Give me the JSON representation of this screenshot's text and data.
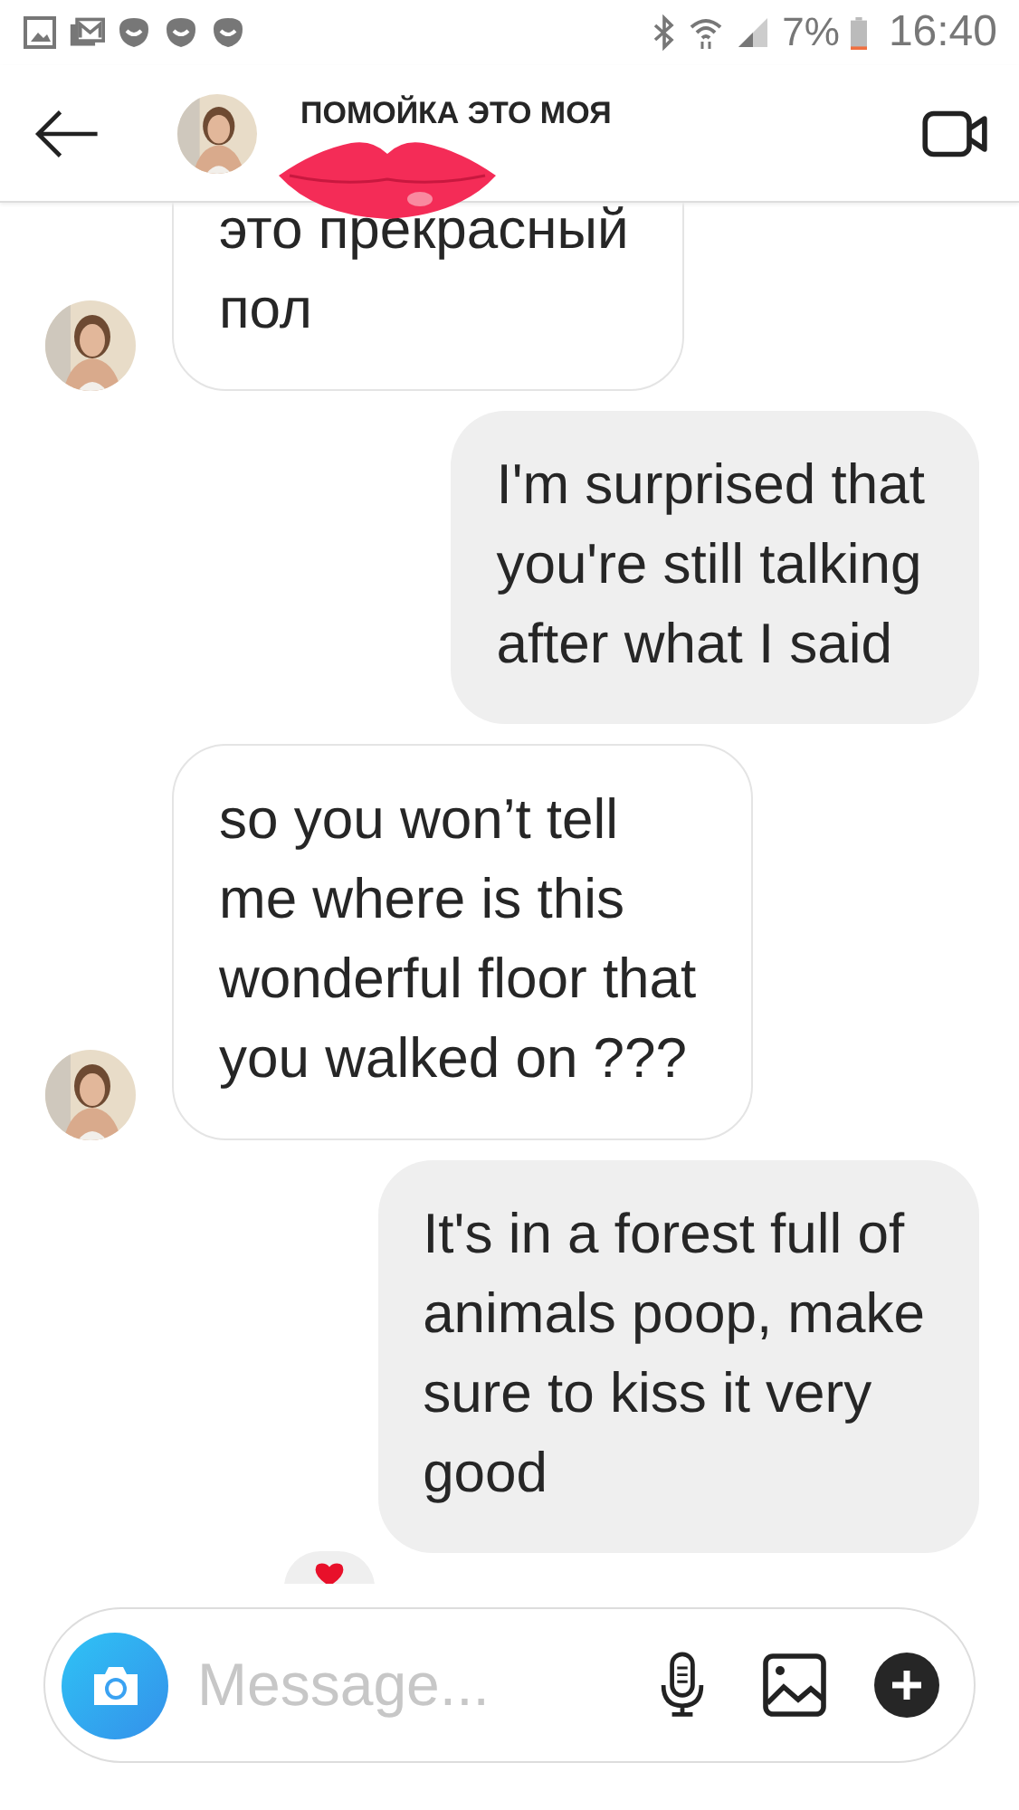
{
  "status_bar": {
    "battery": "7%",
    "time": "16:40"
  },
  "header": {
    "title": "ПОМОЙКА ЭТО МОЯ"
  },
  "messages": [
    {
      "kind": "incoming",
      "text": "это прекрасный\nпол",
      "reacted": false
    },
    {
      "kind": "outgoing",
      "text": "I'm surprised that\nyou're still talking\nafter what I said",
      "reacted": false
    },
    {
      "kind": "incoming",
      "text": "so you won’t tell\nme where is this\nwonderful floor that\nyou walked on ???",
      "reacted": false
    },
    {
      "kind": "outgoing",
      "text": "It's in a forest full of\nanimals poop, make\nsure to kiss it very\ngood",
      "reacted": true
    }
  ],
  "composer": {
    "placeholder": "Message..."
  }
}
